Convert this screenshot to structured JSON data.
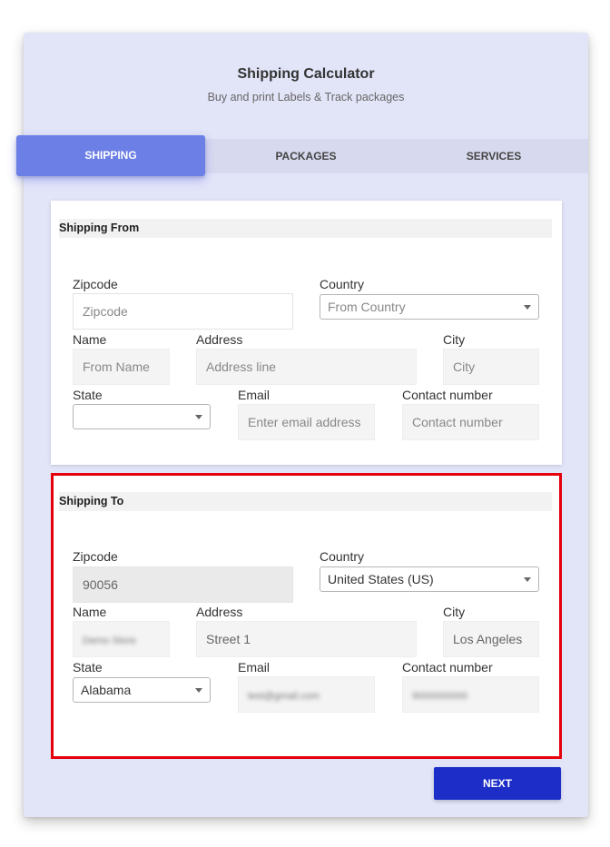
{
  "header": {
    "title": "Shipping Calculator",
    "subtitle": "Buy and print Labels & Track packages"
  },
  "tabs": [
    {
      "label": "SHIPPING",
      "active": true
    },
    {
      "label": "PACKAGES",
      "active": false
    },
    {
      "label": "SERVICES",
      "active": false
    }
  ],
  "shipping_from": {
    "heading": "Shipping From",
    "zipcode": {
      "label": "Zipcode",
      "value": "",
      "placeholder": "Zipcode"
    },
    "country": {
      "label": "Country",
      "value": "",
      "placeholder": "From Country"
    },
    "name": {
      "label": "Name",
      "value": "",
      "placeholder": "From Name"
    },
    "address": {
      "label": "Address",
      "value": "",
      "placeholder": "Address line"
    },
    "city": {
      "label": "City",
      "value": "",
      "placeholder": "City"
    },
    "state": {
      "label": "State",
      "value": ""
    },
    "email": {
      "label": "Email",
      "value": "",
      "placeholder": "Enter email address"
    },
    "contact": {
      "label": "Contact number",
      "value": "",
      "placeholder": "Contact number"
    }
  },
  "shipping_to": {
    "heading": "Shipping To",
    "zipcode": {
      "label": "Zipcode",
      "value": "90056"
    },
    "country": {
      "label": "Country",
      "value": "United States (US)"
    },
    "name": {
      "label": "Name",
      "value": "Demo Store"
    },
    "address": {
      "label": "Address",
      "value": "Street 1"
    },
    "city": {
      "label": "City",
      "value": "Los Angeles"
    },
    "state": {
      "label": "State",
      "value": "Alabama"
    },
    "email": {
      "label": "Email",
      "value": "test@gmail.com"
    },
    "contact": {
      "label": "Contact number",
      "value": "9000000000"
    }
  },
  "actions": {
    "next_label": "NEXT"
  },
  "colors": {
    "accent": "#6b7fe6",
    "primary_button": "#1d2ec8",
    "highlight_border": "#e5000b",
    "card_background": "#e2e4f8"
  }
}
